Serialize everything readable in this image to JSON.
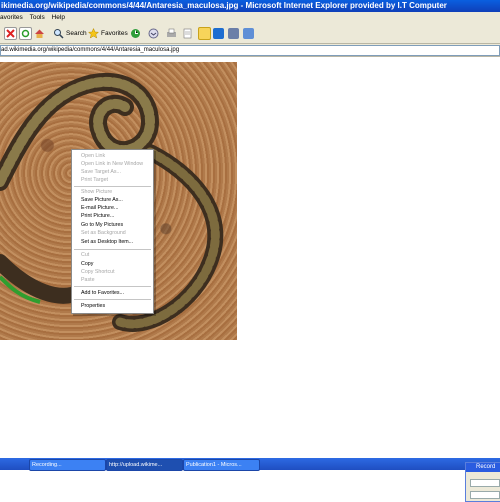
{
  "window": {
    "title": "ikimedia.org/wikipedia/commons/4/44/Antaresia_maculosa.jpg - Microsoft Internet Explorer provided by I.T Computer"
  },
  "menubar": {
    "items": [
      "avorites",
      "Tools",
      "Help"
    ]
  },
  "toolbar": {
    "search_label": "Search",
    "favorites_label": "Favorites"
  },
  "address": {
    "value": "ad.wikimedia.org/wikipedia/commons/4/44/Antaresia_maculosa.jpg"
  },
  "context_menu": {
    "items": [
      {
        "label": "Open Link",
        "enabled": false
      },
      {
        "label": "Open Link in New Window",
        "enabled": false
      },
      {
        "label": "Save Target As...",
        "enabled": false
      },
      {
        "label": "Print Target",
        "enabled": false
      },
      {
        "label": "Show Picture",
        "enabled": false
      },
      {
        "label": "Save Picture As...",
        "enabled": true
      },
      {
        "label": "E-mail Picture...",
        "enabled": true
      },
      {
        "label": "Print Picture...",
        "enabled": true
      },
      {
        "label": "Go to My Pictures",
        "enabled": true
      },
      {
        "label": "Set as Background",
        "enabled": false
      },
      {
        "label": "Set as Desktop Item...",
        "enabled": true
      },
      {
        "label": "Cut",
        "enabled": false
      },
      {
        "label": "Copy",
        "enabled": true
      },
      {
        "label": "Copy Shortcut",
        "enabled": false
      },
      {
        "label": "Paste",
        "enabled": false
      },
      {
        "label": "Add to Favorites...",
        "enabled": true
      },
      {
        "label": "Properties",
        "enabled": true
      }
    ]
  },
  "taskbar": {
    "buttons": [
      {
        "label": "Recording..."
      },
      {
        "label": "http://upload.wikime..."
      },
      {
        "label": "Publication1 - Micros..."
      }
    ]
  },
  "recorder": {
    "title": "Record"
  },
  "colors": {
    "titlebar": "#0f3fb8",
    "taskbar": "#1f4ec1",
    "chrome": "#ece9d8"
  }
}
